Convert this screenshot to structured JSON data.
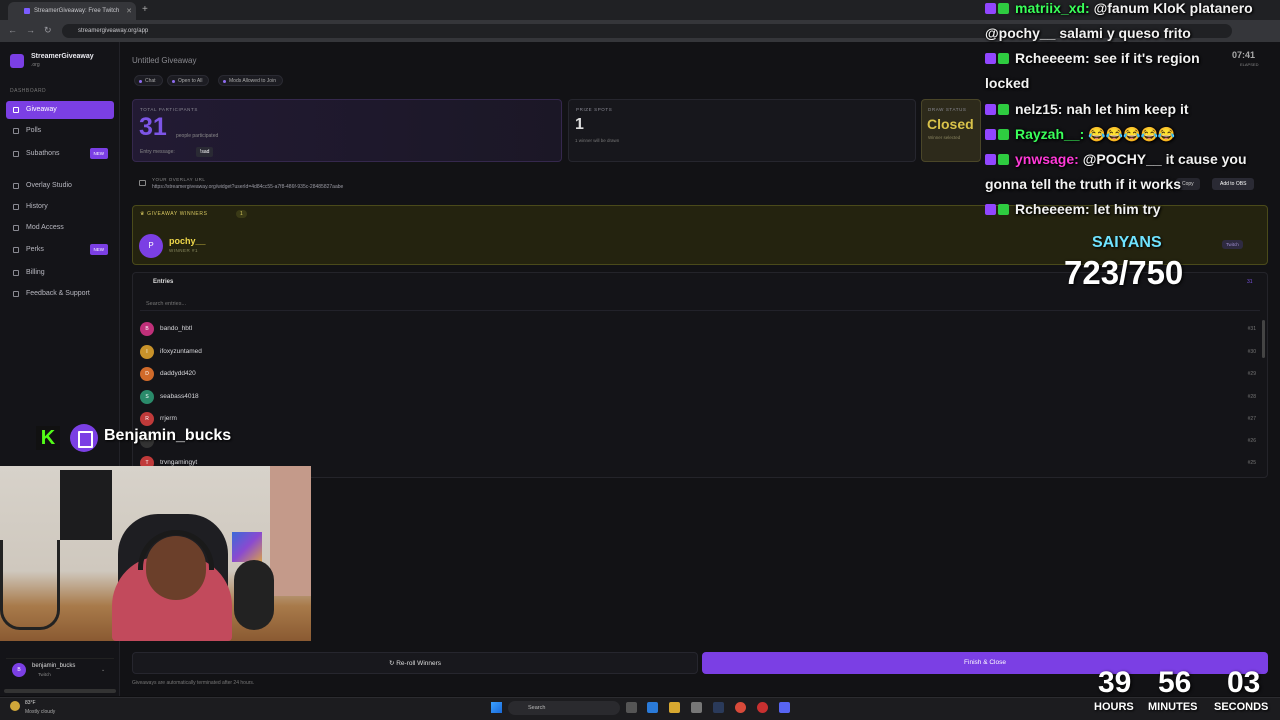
{
  "browser": {
    "tab_title": "StreamerGiveaway: Free Twitch",
    "url": "streamergiveaway.org/app"
  },
  "sidebar": {
    "brand": "StreamerGiveaway",
    "brand_sub": ".org",
    "section": "DASHBOARD",
    "items": [
      {
        "label": "Giveaway",
        "active": true
      },
      {
        "label": "Polls"
      },
      {
        "label": "Subathons",
        "badge": "NEW"
      },
      {
        "label": "Overlay Studio"
      },
      {
        "label": "History"
      },
      {
        "label": "Mod Access"
      },
      {
        "label": "Perks",
        "badge": "NEW"
      },
      {
        "label": "Billing"
      },
      {
        "label": "Feedback & Support"
      }
    ],
    "user": {
      "initial": "B",
      "name": "benjamin_bucks",
      "platform": "Twitch"
    }
  },
  "main": {
    "title": "Untitled Giveaway",
    "chips": [
      "Chat",
      "Open to All",
      "Mods Allowed to Join"
    ],
    "participants": {
      "label": "TOTAL PARTICIPANTS",
      "count": "31",
      "desc": "people participated",
      "entry_label": "Entry message:",
      "entry_value": "!sad"
    },
    "prize": {
      "label": "PRIZE SPOTS",
      "count": "1",
      "desc": "1 winner will be drawn"
    },
    "draw": {
      "label": "DRAW STATUS",
      "value": "Closed",
      "desc": "Winner selected"
    },
    "overlay": {
      "label": "YOUR OVERLAY URL",
      "url": "https://streamergiveaway.org/widget?userId=4d84cc55-a7f8-486f-935c-28485827aabe",
      "copy": "Copy",
      "obs": "Add to OBS"
    },
    "winners": {
      "label": "GIVEAWAY WINNERS",
      "count": "1",
      "initial": "P",
      "name": "pochy__",
      "sub": "WINNER #1",
      "platform": "Twitch"
    },
    "entries": {
      "label": "Entries",
      "count": "31",
      "search_placeholder": "Search entries...",
      "rows": [
        {
          "initial": "B",
          "name": "bando_hbtl",
          "num": "#31",
          "color": "#c0307a"
        },
        {
          "initial": "I",
          "name": "ifoxyzuntamed",
          "num": "#30",
          "color": "#c8922a"
        },
        {
          "initial": "D",
          "name": "daddydd420",
          "num": "#29",
          "color": "#d06a2a"
        },
        {
          "initial": "S",
          "name": "seabass4018",
          "num": "#28",
          "color": "#2a8a6a"
        },
        {
          "initial": "R",
          "name": "rrjerm",
          "num": "#27",
          "color": "#c03a3a"
        },
        {
          "initial": "",
          "name": "",
          "num": "#26",
          "color": "#333"
        },
        {
          "initial": "T",
          "name": "trvngamingyt",
          "num": "#25",
          "color": "#c03a3a"
        }
      ]
    },
    "reroll": "Re-roll Winners",
    "finish": "Finish & Close",
    "auto_note": "Giveaways are automatically terminated after 24 hours."
  },
  "taskbar": {
    "temp": "83°F",
    "weather": "Mostly cloudy",
    "search": "Search"
  },
  "stream": {
    "chat": [
      {
        "user": "matriix_xd:",
        "user_color": "#3aff5a",
        "msg": "@fanum KloK platanero"
      },
      {
        "user": "",
        "user_color": "#fff",
        "msg": "@pochy__ salami y queso frito"
      },
      {
        "user": "Rcheeeem:",
        "user_color": "#f2f2f2",
        "msg": "see if it's region"
      },
      {
        "user": "",
        "user_color": "#fff",
        "msg": "locked"
      },
      {
        "user": "nelz15:",
        "user_color": "#f2f2f2",
        "msg": "nah let him keep it"
      },
      {
        "user": "Rayzah__:",
        "user_color": "#3aff5a",
        "msg": "😂😂😂😂😂"
      },
      {
        "user": "ynwsage:",
        "user_color": "#ff3ad8",
        "msg": "@POCHY__ it cause you"
      },
      {
        "user": "",
        "user_color": "#fff",
        "msg": "gonna tell the truth if it works"
      },
      {
        "user": "Rcheeeem:",
        "user_color": "#f2f2f2",
        "msg": "let him try"
      }
    ],
    "elapsed": "07:41",
    "elapsed_label": "ELAPSED",
    "goal_label": "SAIYANS",
    "goal_count": "723/750",
    "goal_progress": 0.964,
    "handle": "Benjamin_bucks",
    "countdown": {
      "hours": "39",
      "minutes": "56",
      "seconds": "03",
      "hours_label": "HOURS",
      "minutes_label": "MINUTES",
      "seconds_label": "SECONDS"
    }
  }
}
